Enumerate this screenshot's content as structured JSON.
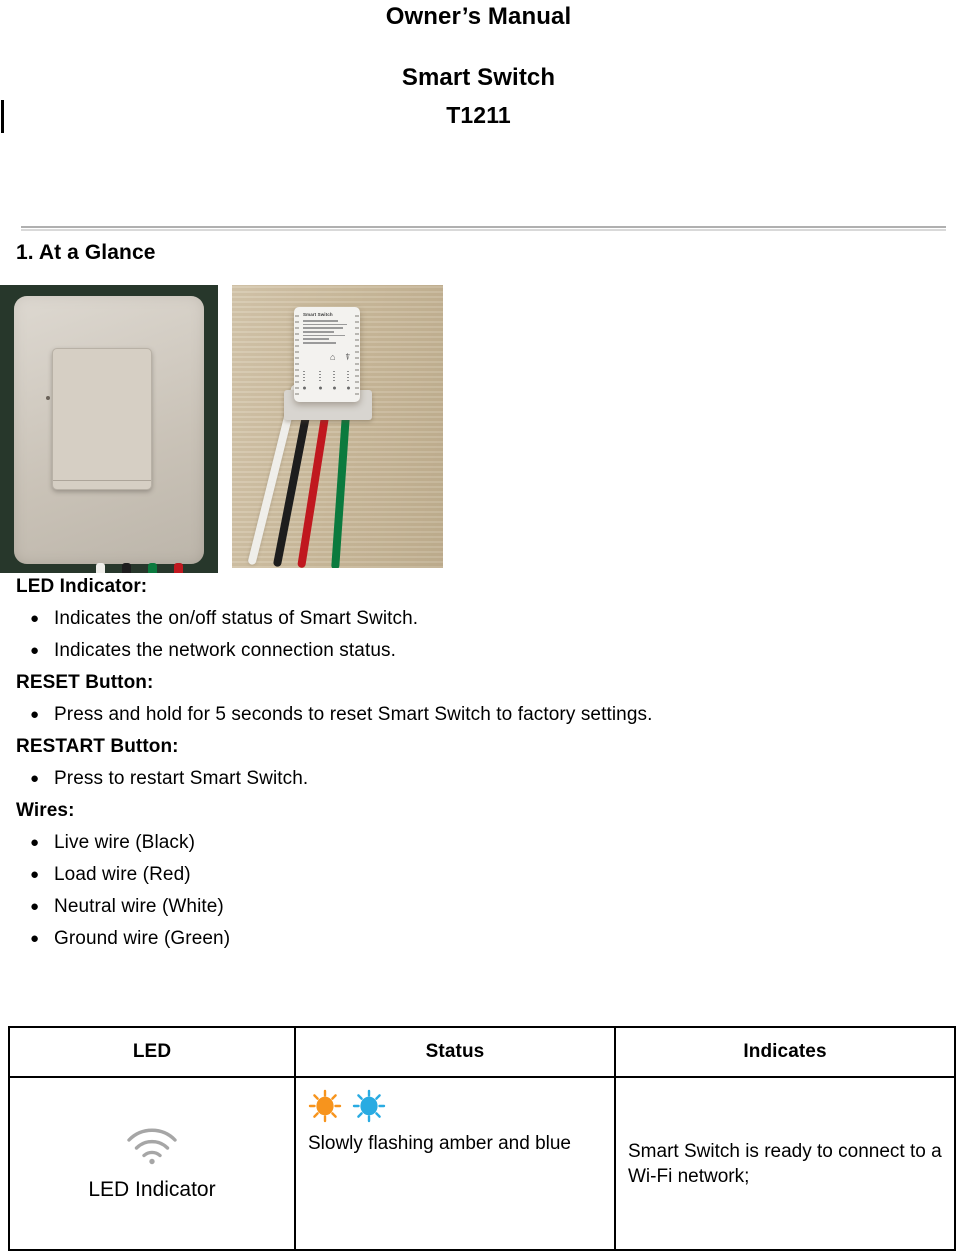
{
  "document": {
    "title": "Owner’s Manual",
    "product": "Smart Switch",
    "model": "T1211"
  },
  "section": {
    "heading": "1. At a Glance"
  },
  "photos": [
    {
      "name": "wall-switch-front-photo",
      "alt": "Smart Switch wall plate front view on dark green background",
      "brand_text": "",
      "wire_colors": [
        "#efeeea",
        "#1d1d1d",
        "#c0181f",
        "#0b7a3e"
      ]
    },
    {
      "name": "smart-switch-module-photo",
      "alt": "Smart Switch module with four wires on wooden surface",
      "device_label_title": "Smart Switch",
      "wire_colors": [
        "#efeeea",
        "#1d1d1d",
        "#c0181f",
        "#0b7a3e"
      ]
    }
  ],
  "features": [
    {
      "heading": "LED Indicator:",
      "items": [
        "Indicates the on/off status of Smart Switch.",
        "Indicates the network connection status."
      ]
    },
    {
      "heading": "RESET Button:",
      "items": [
        "Press and hold for 5 seconds to reset Smart Switch to factory settings."
      ]
    },
    {
      "heading": "RESTART Button:",
      "items": [
        "Press to restart Smart Switch."
      ]
    },
    {
      "heading": "Wires:",
      "items": [
        "Live wire (Black)",
        "Load wire (Red)",
        "Neutral wire (White)",
        "Ground wire (Green)"
      ]
    }
  ],
  "led_table": {
    "columns": [
      "LED",
      "Status",
      "Indicates"
    ],
    "rows": [
      {
        "led_icon": "wifi-icon",
        "led_label": "LED Indicator",
        "status_icons": [
          "amber-flash-icon",
          "blue-flash-icon"
        ],
        "status": "Slowly flashing amber and blue",
        "indicates": "Smart Switch is ready to connect to a Wi-Fi network;"
      }
    ]
  },
  "colors": {
    "amber": "#F7941D",
    "blue": "#29ABE2",
    "wifi_gray": "#A6A6A6",
    "rule_dark": "#B0B0B0",
    "rule_light": "#D9D9D9",
    "text": "#000000"
  },
  "bullet_glyph": "●"
}
